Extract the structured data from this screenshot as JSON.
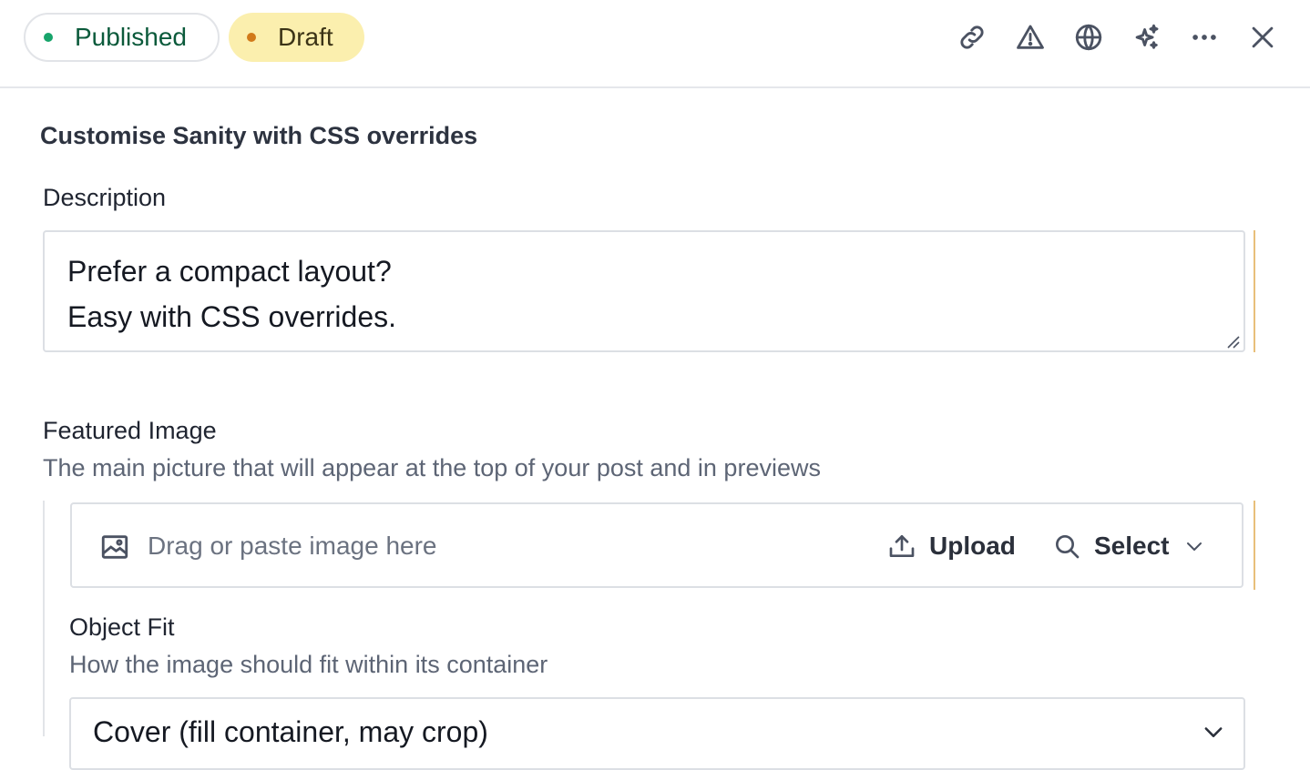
{
  "status": {
    "published_label": "Published",
    "draft_label": "Draft",
    "published_color": "#17a46b",
    "draft_color": "#d17a1a"
  },
  "toolbar": {
    "icons": [
      "link-icon",
      "warning-icon",
      "globe-icon",
      "sparkles-icon",
      "more-icon",
      "close-icon"
    ]
  },
  "document": {
    "title": "Customise Sanity with CSS overrides"
  },
  "fields": {
    "description": {
      "label": "Description",
      "value_line1": "Prefer a compact layout?",
      "value_line2": "Easy with CSS overrides."
    },
    "featured_image": {
      "label": "Featured Image",
      "description": "The main picture that will appear at the top of your post and in previews",
      "drop_text": "Drag or paste image here",
      "upload_label": "Upload",
      "select_label": "Select"
    },
    "object_fit": {
      "label": "Object Fit",
      "description": "How the image should fit within its container",
      "selected": "Cover (fill container, may crop)"
    }
  }
}
